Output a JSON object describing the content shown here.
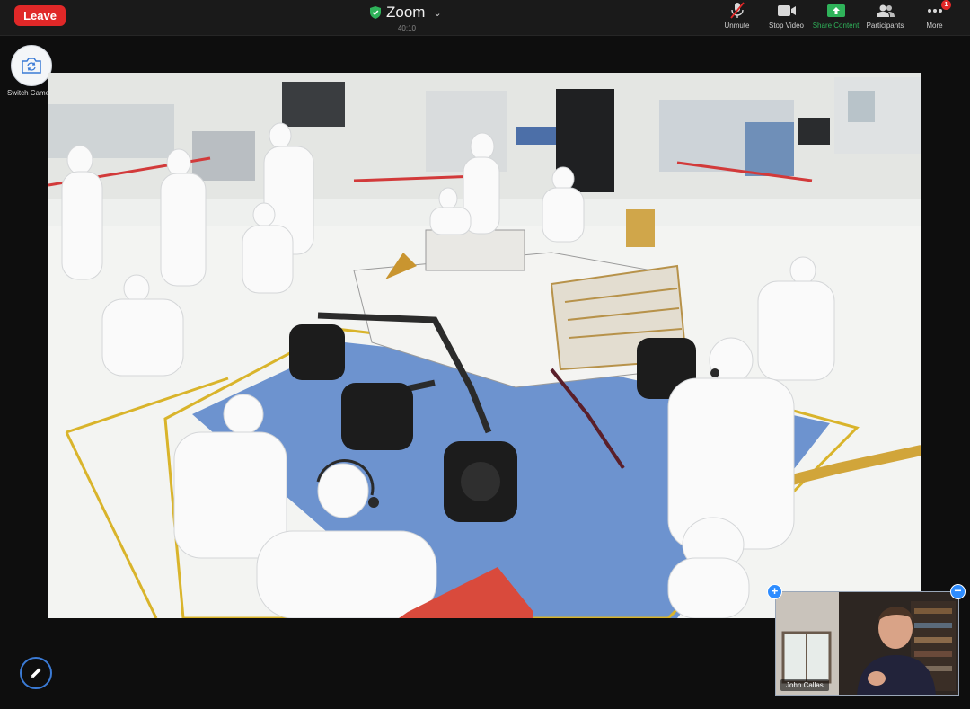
{
  "toolbar": {
    "leave_label": "Leave",
    "title": "Zoom",
    "timer": "40:10",
    "items": [
      {
        "label": "Unmute",
        "icon": "microphone-muted-icon"
      },
      {
        "label": "Stop Video",
        "icon": "video-camera-icon"
      },
      {
        "label": "Share Content",
        "icon": "share-screen-icon"
      },
      {
        "label": "Participants",
        "icon": "participants-icon"
      },
      {
        "label": "More",
        "icon": "more-icon",
        "badge": "1"
      }
    ]
  },
  "switch_camera": {
    "label": "Switch Camera",
    "icon": "camera-switch-icon"
  },
  "shared_content": {
    "description_icon": "shared-photo"
  },
  "annotate": {
    "icon": "pencil-icon"
  },
  "self_view": {
    "name": "John Callas"
  },
  "colors": {
    "leave": "#e02828",
    "accent": "#2d8cff",
    "share_green": "#2fb35a",
    "secure_green": "#2fb35a",
    "topbar": "#1a1a1a"
  }
}
